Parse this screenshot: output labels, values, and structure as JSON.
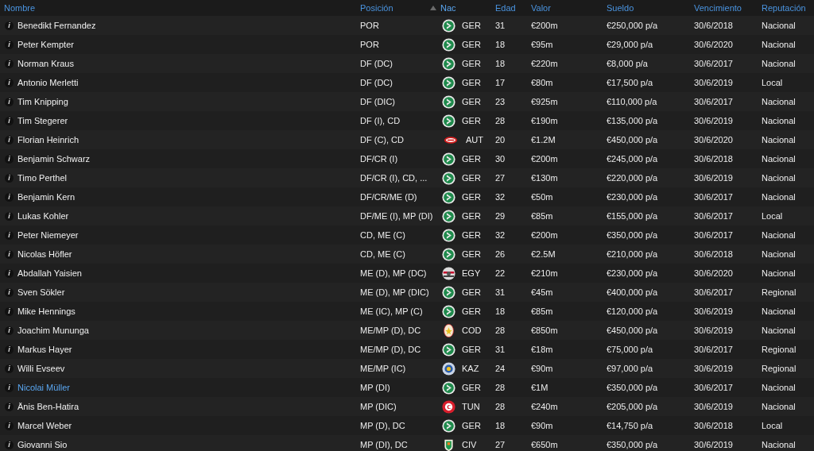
{
  "columns": [
    {
      "label": "Nombre",
      "sorted": false
    },
    {
      "label": "Posición",
      "sorted": false
    },
    {
      "label": "Nac",
      "sorted": true
    },
    {
      "label": "Edad",
      "sorted": false
    },
    {
      "label": "Valor",
      "sorted": false
    },
    {
      "label": "Sueldo",
      "sorted": false
    },
    {
      "label": "Vencimiento",
      "sorted": false
    },
    {
      "label": "Reputación",
      "sorted": false
    }
  ],
  "rows": [
    {
      "info": "i",
      "name": "Benedikt Fernandez",
      "highlighted": false,
      "position": "POR",
      "crest": {
        "kind": "dfb"
      },
      "nation": "GER",
      "age": "31",
      "value": "€200m",
      "wage": "€250,000 p/a",
      "expires": "30/6/2018",
      "reputation": "Nacional"
    },
    {
      "info": "i",
      "name": "Peter Kempter",
      "highlighted": false,
      "position": "POR",
      "crest": {
        "kind": "dfb"
      },
      "nation": "GER",
      "age": "18",
      "value": "€95m",
      "wage": "€29,000 p/a",
      "expires": "30/6/2020",
      "reputation": "Nacional"
    },
    {
      "info": "i",
      "name": "Norman Kraus",
      "highlighted": false,
      "position": "DF (DC)",
      "crest": {
        "kind": "dfb"
      },
      "nation": "GER",
      "age": "18",
      "value": "€220m",
      "wage": "€8,000 p/a",
      "expires": "30/6/2017",
      "reputation": "Nacional"
    },
    {
      "info": "i",
      "name": "Antonio Merletti",
      "highlighted": false,
      "position": "DF (DC)",
      "crest": {
        "kind": "dfb"
      },
      "nation": "GER",
      "age": "17",
      "value": "€80m",
      "wage": "€17,500 p/a",
      "expires": "30/6/2019",
      "reputation": "Local"
    },
    {
      "info": "i",
      "name": "Tim Knipping",
      "highlighted": false,
      "position": "DF (DIC)",
      "crest": {
        "kind": "dfb"
      },
      "nation": "GER",
      "age": "23",
      "value": "€925m",
      "wage": "€110,000 p/a",
      "expires": "30/6/2017",
      "reputation": "Nacional"
    },
    {
      "info": "i",
      "name": "Tim Stegerer",
      "highlighted": false,
      "position": "DF (I), CD",
      "crest": {
        "kind": "dfb"
      },
      "nation": "GER",
      "age": "28",
      "value": "€190m",
      "wage": "€135,000 p/a",
      "expires": "30/6/2019",
      "reputation": "Nacional"
    },
    {
      "info": "i",
      "name": "Florian Heinrich",
      "highlighted": false,
      "position": "DF (C), CD",
      "crest": {
        "kind": "ofb"
      },
      "nation": "AUT",
      "age": "20",
      "value": "€1.2M",
      "wage": "€450,000 p/a",
      "expires": "30/6/2020",
      "reputation": "Nacional"
    },
    {
      "info": "i",
      "name": "Benjamin Schwarz",
      "highlighted": false,
      "position": "DF/CR (I)",
      "crest": {
        "kind": "dfb"
      },
      "nation": "GER",
      "age": "30",
      "value": "€200m",
      "wage": "€245,000 p/a",
      "expires": "30/6/2018",
      "reputation": "Nacional"
    },
    {
      "info": "i",
      "name": "Timo Perthel",
      "highlighted": false,
      "position": "DF/CR (I), CD, ...",
      "crest": {
        "kind": "dfb"
      },
      "nation": "GER",
      "age": "27",
      "value": "€130m",
      "wage": "€220,000 p/a",
      "expires": "30/6/2019",
      "reputation": "Nacional"
    },
    {
      "info": "i",
      "name": "Benjamin Kern",
      "highlighted": false,
      "position": "DF/CR/ME (D)",
      "crest": {
        "kind": "dfb"
      },
      "nation": "GER",
      "age": "32",
      "value": "€50m",
      "wage": "€230,000 p/a",
      "expires": "30/6/2017",
      "reputation": "Nacional"
    },
    {
      "info": "i",
      "name": "Lukas Kohler",
      "highlighted": false,
      "position": "DF/ME (I), MP (DI)",
      "crest": {
        "kind": "dfb"
      },
      "nation": "GER",
      "age": "29",
      "value": "€85m",
      "wage": "€155,000 p/a",
      "expires": "30/6/2017",
      "reputation": "Local"
    },
    {
      "info": "i",
      "name": "Peter Niemeyer",
      "highlighted": false,
      "position": "CD, ME (C)",
      "crest": {
        "kind": "dfb"
      },
      "nation": "GER",
      "age": "32",
      "value": "€200m",
      "wage": "€350,000 p/a",
      "expires": "30/6/2017",
      "reputation": "Nacional"
    },
    {
      "info": "i",
      "name": "Nicolas Höfler",
      "highlighted": false,
      "position": "CD, ME (C)",
      "crest": {
        "kind": "dfb"
      },
      "nation": "GER",
      "age": "26",
      "value": "€2.5M",
      "wage": "€210,000 p/a",
      "expires": "30/6/2018",
      "reputation": "Nacional"
    },
    {
      "info": "i",
      "name": "Abdallah Yaisien",
      "highlighted": false,
      "position": "ME (D), MP (DC)",
      "crest": {
        "kind": "egy"
      },
      "nation": "EGY",
      "age": "22",
      "value": "€210m",
      "wage": "€230,000 p/a",
      "expires": "30/6/2020",
      "reputation": "Nacional"
    },
    {
      "info": "i",
      "name": "Sven Sökler",
      "highlighted": false,
      "position": "ME (D), MP (DIC)",
      "crest": {
        "kind": "dfb"
      },
      "nation": "GER",
      "age": "31",
      "value": "€45m",
      "wage": "€400,000 p/a",
      "expires": "30/6/2017",
      "reputation": "Regional"
    },
    {
      "info": "i",
      "name": "Mike Hennings",
      "highlighted": false,
      "position": "ME (IC), MP (C)",
      "crest": {
        "kind": "dfb"
      },
      "nation": "GER",
      "age": "18",
      "value": "€85m",
      "wage": "€120,000 p/a",
      "expires": "30/6/2019",
      "reputation": "Nacional"
    },
    {
      "info": "i",
      "name": "Joachim Mununga",
      "highlighted": false,
      "position": "ME/MP (D), DC",
      "crest": {
        "kind": "cod"
      },
      "nation": "COD",
      "age": "28",
      "value": "€850m",
      "wage": "€450,000 p/a",
      "expires": "30/6/2019",
      "reputation": "Nacional"
    },
    {
      "info": "i",
      "name": "Markus Hayer",
      "highlighted": false,
      "position": "ME/MP (D), DC",
      "crest": {
        "kind": "dfb"
      },
      "nation": "GER",
      "age": "31",
      "value": "€18m",
      "wage": "€75,000 p/a",
      "expires": "30/6/2017",
      "reputation": "Regional"
    },
    {
      "info": "i",
      "name": "Willi Evseev",
      "highlighted": false,
      "position": "ME/MP (IC)",
      "crest": {
        "kind": "kaz"
      },
      "nation": "KAZ",
      "age": "24",
      "value": "€90m",
      "wage": "€97,000 p/a",
      "expires": "30/6/2019",
      "reputation": "Regional"
    },
    {
      "info": "i",
      "name": "Nicolai Müller",
      "highlighted": true,
      "position": "MP (DI)",
      "crest": {
        "kind": "dfb"
      },
      "nation": "GER",
      "age": "28",
      "value": "€1M",
      "wage": "€350,000 p/a",
      "expires": "30/6/2017",
      "reputation": "Nacional"
    },
    {
      "info": "i",
      "name": "Änis Ben-Hatira",
      "highlighted": false,
      "position": "MP (DIC)",
      "crest": {
        "kind": "tun"
      },
      "nation": "TUN",
      "age": "28",
      "value": "€240m",
      "wage": "€205,000 p/a",
      "expires": "30/6/2019",
      "reputation": "Nacional"
    },
    {
      "info": "i",
      "name": "Marcel Weber",
      "highlighted": false,
      "position": "MP (D), DC",
      "crest": {
        "kind": "dfb"
      },
      "nation": "GER",
      "age": "18",
      "value": "€90m",
      "wage": "€14,750 p/a",
      "expires": "30/6/2018",
      "reputation": "Local"
    },
    {
      "info": "i",
      "name": "Giovanni Sio",
      "highlighted": false,
      "position": "MP (DI), DC",
      "crest": {
        "kind": "civ"
      },
      "nation": "CIV",
      "age": "27",
      "value": "€650m",
      "wage": "€350,000 p/a",
      "expires": "30/6/2019",
      "reputation": "Nacional"
    }
  ]
}
